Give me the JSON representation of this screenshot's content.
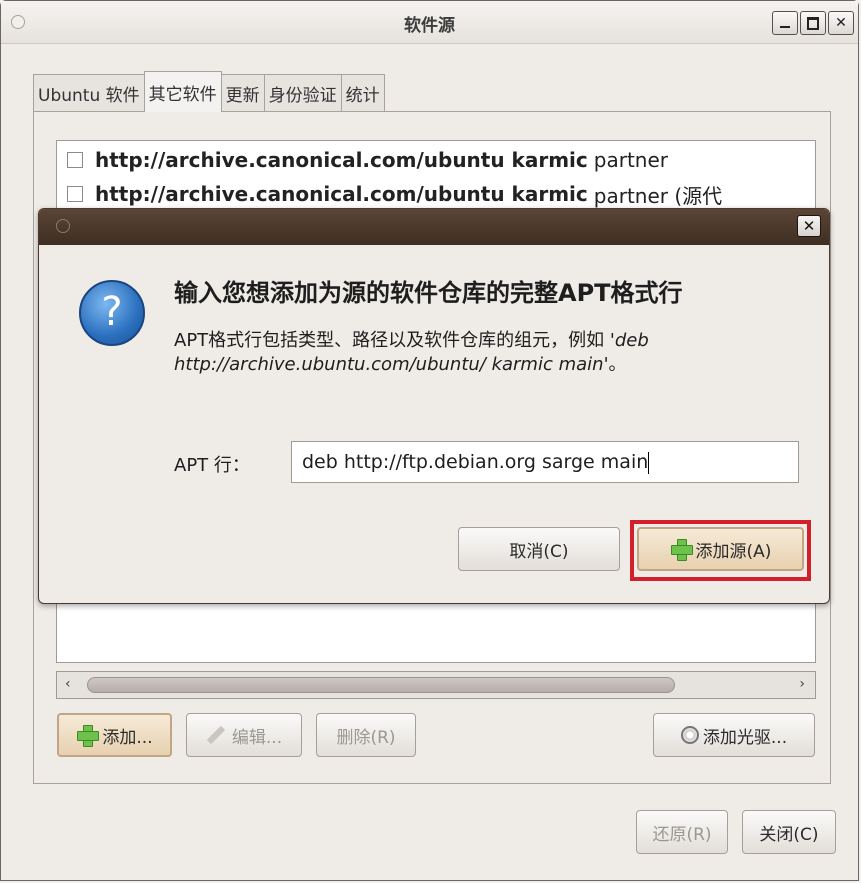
{
  "window": {
    "title": "软件源"
  },
  "tabs": [
    {
      "label": "Ubuntu 软件"
    },
    {
      "label": "其它软件"
    },
    {
      "label": "更新"
    },
    {
      "label": "身份验证"
    },
    {
      "label": "统计"
    }
  ],
  "sources": [
    {
      "url": "http://archive.canonical.com/ubuntu karmic",
      "component": "partner"
    },
    {
      "url": "http://archive.canonical.com/ubuntu karmic",
      "component": "partner (源代"
    }
  ],
  "list_buttons": {
    "add": "添加...",
    "edit": "编辑...",
    "remove": "删除(R)",
    "add_cdrom": "添加光驱..."
  },
  "footer_buttons": {
    "revert": "还原(R)",
    "close": "关闭(C)"
  },
  "dialog": {
    "heading": "输入您想添加为源的软件仓库的完整APT格式行",
    "desc_prefix": "APT格式行包括类型、路径以及软件仓库的组元，例如 '",
    "desc_example": "deb http://archive.ubuntu.com/ubuntu/ karmic main",
    "desc_suffix": "'。",
    "apt_label": "APT 行：",
    "apt_value": "deb http://ftp.debian.org sarge main",
    "cancel": "取消(C)",
    "add_source": "添加源(A)"
  }
}
